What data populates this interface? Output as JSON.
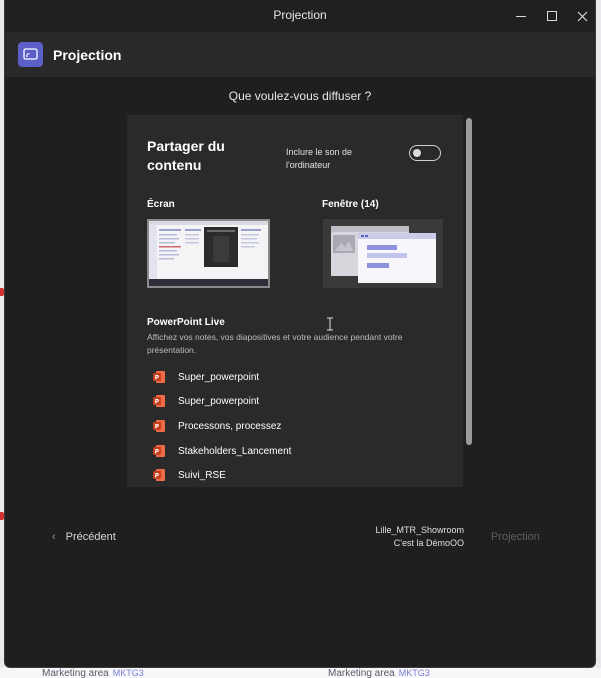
{
  "window": {
    "title": "Projection",
    "header_title": "Projection"
  },
  "dialog": {
    "question": "Que voulez-vous diffuser ?",
    "panel_title": "Partager du contenu",
    "sound_label": "Inclure le son de l'ordinateur",
    "sound_enabled": false,
    "screen_label": "Écran",
    "window_label": "Fenêtre (14)",
    "powerpoint": {
      "title": "PowerPoint Live",
      "description": "Affichez vos notes, vos diapositives et votre audience pendant votre présentation.",
      "files": [
        "Super_powerpoint",
        "Super_powerpoint",
        "Processons, processez",
        "Stakeholders_Lancement",
        "Suivi_RSE"
      ]
    }
  },
  "footer": {
    "previous": "Précédent",
    "room_name": "Lille_MTR_Showroom",
    "meeting_name": "C'est la DémoOO",
    "project_button": "Projection"
  },
  "background": {
    "label_1": "Marketing area",
    "tag_1": "MKTG3",
    "label_2": "Marketing area",
    "tag_2": "MKTG3"
  },
  "colors": {
    "accent": "#5b5fc7",
    "dialog_bg": "#1f1f1f",
    "panel_bg": "#2a2a2a",
    "ppt_red": "#c43e1c"
  },
  "icons": {
    "header": "cast-screen-icon",
    "file": "powerpoint-file-icon",
    "back": "chevron-left-icon"
  }
}
